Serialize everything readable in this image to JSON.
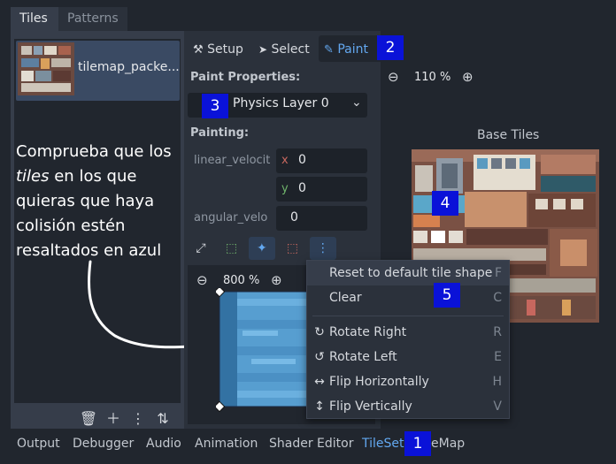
{
  "top_tabs": [
    {
      "label": "Tiles"
    },
    {
      "label": "Patterns"
    }
  ],
  "source": {
    "label": "tilemap_packe..."
  },
  "annotation": {
    "line1": "Comprueba que los",
    "line2_em": "tiles",
    "line2_rest": " en los que",
    "line3": "quieras que haya",
    "line4": "colisión estén",
    "line5": "resaltados en azul"
  },
  "toolbar": {
    "setup": "Setup",
    "select": "Select",
    "paint": "Paint"
  },
  "paint_properties": {
    "title": "Paint Properties:",
    "layer": "Physics Layer 0",
    "painting_title": "Painting:",
    "linear_label": "linear_velocit",
    "x_axis": "x",
    "x_value": "0",
    "y_axis": "y",
    "y_value": "0",
    "angular_label": "angular_velo",
    "angular_value": "0"
  },
  "editor": {
    "zoom": "800 %"
  },
  "atlas": {
    "zoom": "110 %",
    "title": "Base Tiles"
  },
  "context_menu": {
    "items": [
      {
        "label": "Reset to default tile shape",
        "shortcut": "F"
      },
      {
        "label": "Clear",
        "shortcut": "C"
      },
      {
        "label": "Rotate Right",
        "shortcut": "R"
      },
      {
        "label": "Rotate Left",
        "shortcut": "E"
      },
      {
        "label": "Flip Horizontally",
        "shortcut": "H"
      },
      {
        "label": "Flip Vertically",
        "shortcut": "V"
      }
    ]
  },
  "bottom_tabs": [
    {
      "label": "Output"
    },
    {
      "label": "Debugger"
    },
    {
      "label": "Audio"
    },
    {
      "label": "Animation"
    },
    {
      "label": "Shader Editor"
    },
    {
      "label": "TileSet"
    },
    {
      "label": "eMap"
    }
  ],
  "badges": [
    "1",
    "2",
    "3",
    "4",
    "5"
  ],
  "colors": {
    "accent": "#63a8f0",
    "badge": "#0a12d8",
    "collision_tile": "#5aa7c9"
  }
}
